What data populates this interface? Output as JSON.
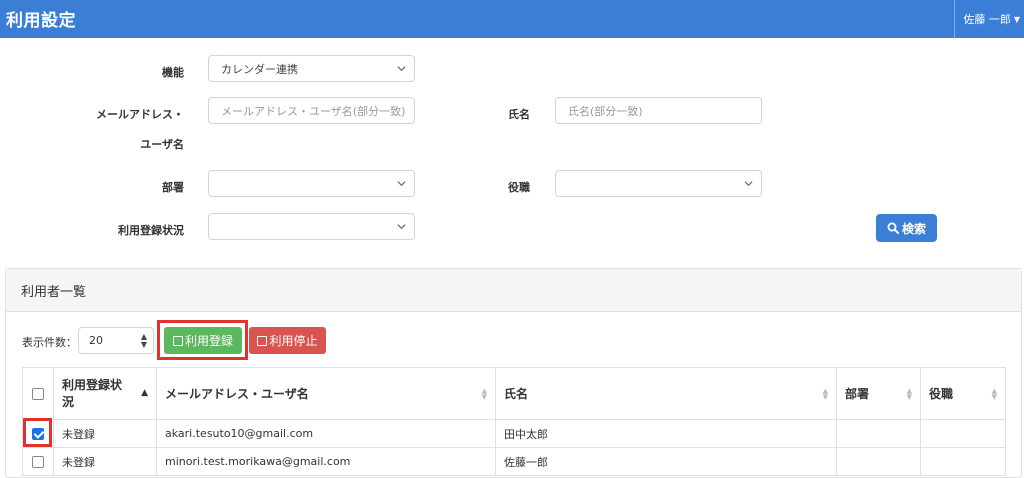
{
  "header": {
    "title": "利用設定",
    "user": "佐藤 一郎"
  },
  "filters": {
    "function_label": "機能",
    "function_value": "カレンダー連携",
    "email_label_line1": "メールアドレス・",
    "email_label_line2": "ユーザ名",
    "email_placeholder": "メールアドレス・ユーザ名(部分一致)",
    "name_label": "氏名",
    "name_placeholder": "氏名(部分一致)",
    "dept_label": "部署",
    "dept_value": "",
    "role_label": "役職",
    "role_value": "",
    "status_label": "利用登録状況",
    "status_value": "",
    "search_label": "検索"
  },
  "panel": {
    "title": "利用者一覧",
    "per_page_label": "表示件数：",
    "per_page_value": "20",
    "register_label": "利用登録",
    "stop_label": "利用停止"
  },
  "table": {
    "columns": [
      "利用登録状況",
      "メールアドレス・ユーザ名",
      "氏名",
      "部署",
      "役職"
    ],
    "rows": [
      {
        "checked": true,
        "status": "未登録",
        "email": "akari.tesuto10@gmail.com",
        "name": "田中太郎",
        "dept": "",
        "role": ""
      },
      {
        "checked": false,
        "status": "未登録",
        "email": "minori.test.morikawa@gmail.com",
        "name": "佐藤一郎",
        "dept": "",
        "role": ""
      }
    ]
  },
  "colors": {
    "header_bg": "#3a7fd5",
    "register_btn": "#5cb85c",
    "stop_btn": "#d9534f",
    "highlight": "#e0332a"
  },
  "icons": [
    "chevron-down-icon",
    "search-icon",
    "checkbox-icon",
    "sort-icon",
    "updown-icon"
  ]
}
